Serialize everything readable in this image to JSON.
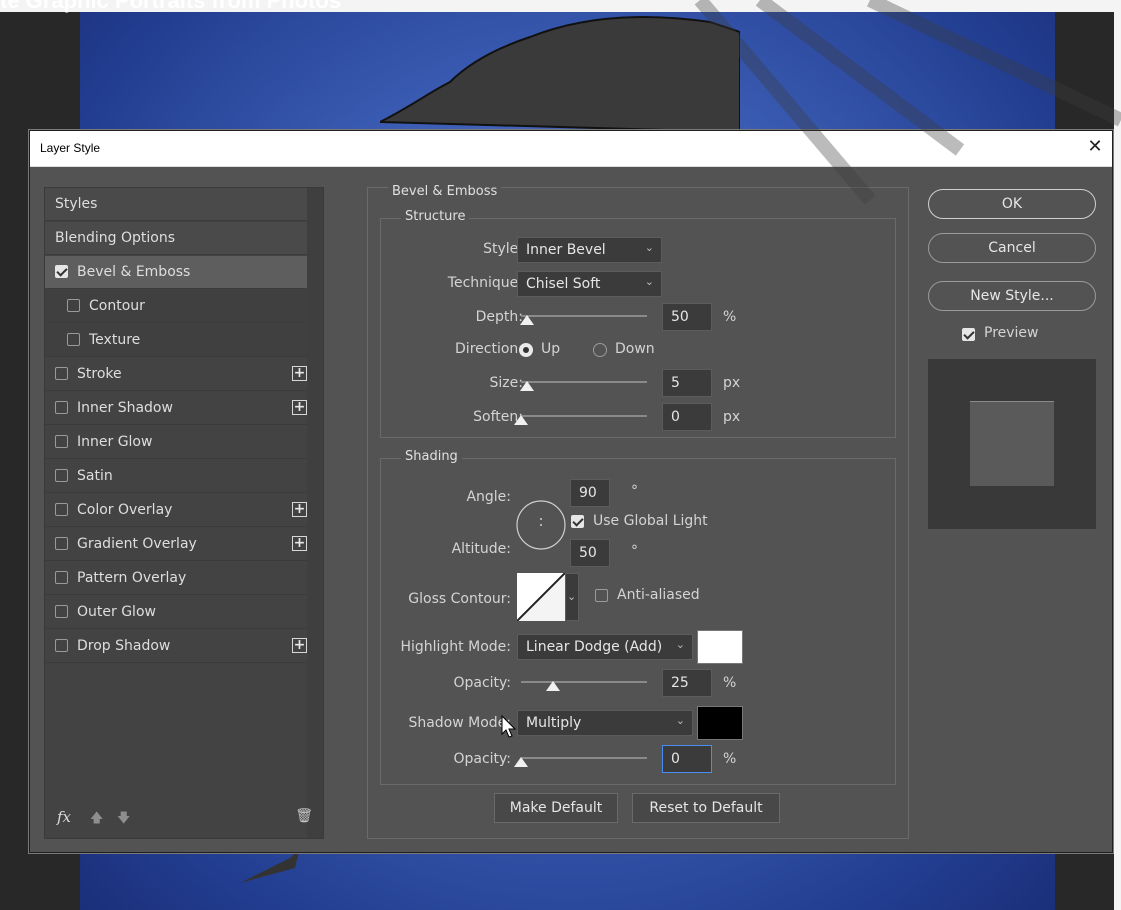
{
  "background": {
    "title": "te Graphic Portraits from Photos"
  },
  "dialog": {
    "title": "Layer Style",
    "close_glyph": "✕"
  },
  "style_list": {
    "items": [
      {
        "label": "Styles",
        "checkbox": false,
        "checked": false,
        "plus": false
      },
      {
        "label": "Blending Options",
        "checkbox": false,
        "checked": false,
        "plus": false
      },
      {
        "label": "Bevel & Emboss",
        "checkbox": true,
        "checked": true,
        "plus": false
      },
      {
        "label": "Contour",
        "checkbox": true,
        "checked": false,
        "plus": false
      },
      {
        "label": "Texture",
        "checkbox": true,
        "checked": false,
        "plus": false
      },
      {
        "label": "Stroke",
        "checkbox": true,
        "checked": false,
        "plus": true
      },
      {
        "label": "Inner Shadow",
        "checkbox": true,
        "checked": false,
        "plus": true
      },
      {
        "label": "Inner Glow",
        "checkbox": true,
        "checked": false,
        "plus": false
      },
      {
        "label": "Satin",
        "checkbox": true,
        "checked": false,
        "plus": false
      },
      {
        "label": "Color Overlay",
        "checkbox": true,
        "checked": false,
        "plus": true
      },
      {
        "label": "Gradient Overlay",
        "checkbox": true,
        "checked": false,
        "plus": true
      },
      {
        "label": "Pattern Overlay",
        "checkbox": true,
        "checked": false,
        "plus": false
      },
      {
        "label": "Outer Glow",
        "checkbox": true,
        "checked": false,
        "plus": false
      },
      {
        "label": "Drop Shadow",
        "checkbox": true,
        "checked": false,
        "plus": true
      }
    ],
    "footer": {
      "fx": "fx",
      "up": "🡅",
      "down": "🡇",
      "trash": "🗑"
    }
  },
  "bevel": {
    "section_title": "Bevel & Emboss",
    "structure_title": "Structure",
    "style_label": "Style:",
    "style_value": "Inner Bevel",
    "technique_label": "Technique:",
    "technique_value": "Chisel Soft",
    "depth_label": "Depth:",
    "depth_value": "50",
    "depth_unit": "%",
    "depth_level": 0.05,
    "direction_label": "Direction:",
    "direction_up": "Up",
    "direction_down": "Down",
    "direction_selected": "Up",
    "size_label": "Size:",
    "size_value": "5",
    "size_unit": "px",
    "size_level": 0.05,
    "soften_label": "Soften:",
    "soften_value": "0",
    "soften_unit": "px",
    "soften_level": 0
  },
  "shading": {
    "title": "Shading",
    "angle_label": "Angle:",
    "angle_value": "90",
    "angle_unit": "°",
    "use_global_light": "Use Global Light",
    "altitude_label": "Altitude:",
    "altitude_value": "50",
    "altitude_unit": "°",
    "gloss_label": "Gloss Contour:",
    "anti_aliased": "Anti-aliased",
    "highlight_label": "Highlight Mode:",
    "highlight_value": "Linear Dodge (Add)",
    "highlight_color": "#ffffff",
    "hl_opacity_label": "Opacity:",
    "hl_opacity_value": "25",
    "hl_opacity_unit": "%",
    "hl_opacity_level": 0.25,
    "shadow_label": "Shadow Mode:",
    "shadow_value": "Multiply",
    "shadow_color": "#000000",
    "sh_opacity_label": "Opacity:",
    "sh_opacity_value": "0",
    "sh_opacity_unit": "%",
    "sh_opacity_level": 0
  },
  "buttons": {
    "make_default": "Make Default",
    "reset_default": "Reset to Default",
    "ok": "OK",
    "cancel": "Cancel",
    "new_style": "New Style...",
    "preview": "Preview"
  }
}
